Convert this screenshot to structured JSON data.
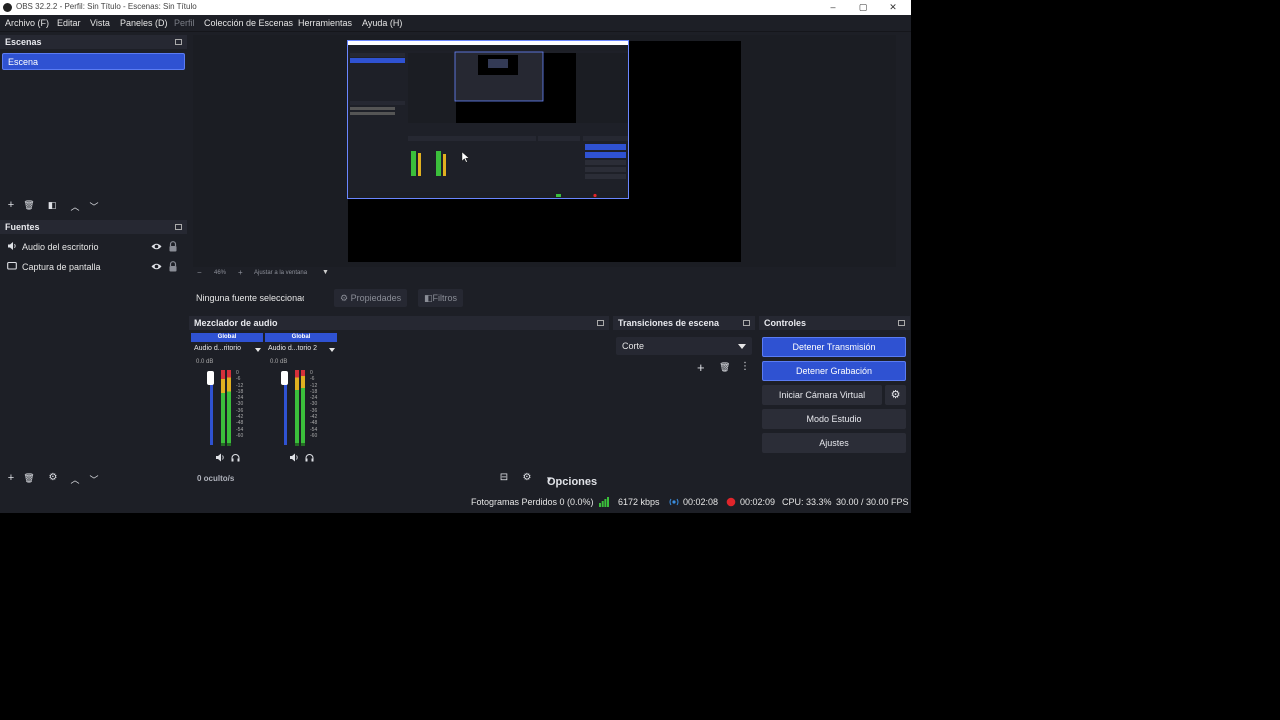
{
  "window": {
    "title": "OBS 32.2.2 - Perfil: Sin Título - Escenas: Sin Título",
    "minimize": "–",
    "maximize": "▢",
    "close": "✕"
  },
  "menu": [
    {
      "label": "Archivo (F)",
      "enabled": true
    },
    {
      "label": "Editar",
      "enabled": true
    },
    {
      "label": "Vista",
      "enabled": true
    },
    {
      "label": "Paneles (D)",
      "enabled": true
    },
    {
      "label": "Perfil",
      "enabled": false
    },
    {
      "label": "Colección de Escenas",
      "enabled": true
    },
    {
      "label": "Herramientas",
      "enabled": true
    },
    {
      "label": "Ayuda (H)",
      "enabled": true
    }
  ],
  "scenes": {
    "header": "Escenas",
    "items": [
      "Escena"
    ]
  },
  "sources": {
    "header": "Fuentes",
    "items": [
      {
        "label": "Audio del escritorio",
        "icon": "speaker-icon"
      },
      {
        "label": "Captura de pantalla",
        "icon": "monitor-icon"
      }
    ]
  },
  "preview": {
    "zoom": "46%",
    "fit_label": "Ajustar a la ventana"
  },
  "context": {
    "no_selection": "Ninguna fuente seleccionada",
    "properties": "Propiedades",
    "filters": "Filtros"
  },
  "mixer": {
    "header": "Mezclador de audio",
    "channels": [
      {
        "tag": "Global",
        "name": "Audio d...ritorio",
        "db": "0.0 dB"
      },
      {
        "tag": "Global",
        "name": "Audio d...torio 2",
        "db": "0.0 dB"
      }
    ],
    "scale": [
      "0",
      "-6",
      "-12",
      "-18",
      "-24",
      "-30",
      "-36",
      "-42",
      "-48",
      "-54",
      "-60"
    ],
    "hidden_count": "0 oculto/s",
    "options": "Opciones"
  },
  "transitions": {
    "header": "Transiciones de escena",
    "selected": "Corte"
  },
  "controls": {
    "header": "Controles",
    "stop_stream": "Detener Transmisión",
    "stop_record": "Detener Grabación",
    "virtual_cam": "Iniciar Cámara Virtual",
    "studio_mode": "Modo Estudio",
    "settings": "Ajustes"
  },
  "status": {
    "dropped_frames": "Fotogramas Perdidos 0 (0.0%)",
    "bitrate": "6172 kbps",
    "stream_time": "00:02:08",
    "record_time": "00:02:09",
    "cpu": "CPU: 33.3%",
    "fps": "30.00 / 30.00 FPS"
  },
  "colors": {
    "accent": "#2f52d2",
    "background": "#1d1f26",
    "recording": "#e0252b",
    "bitrate_ok": "#3bbf3b"
  }
}
